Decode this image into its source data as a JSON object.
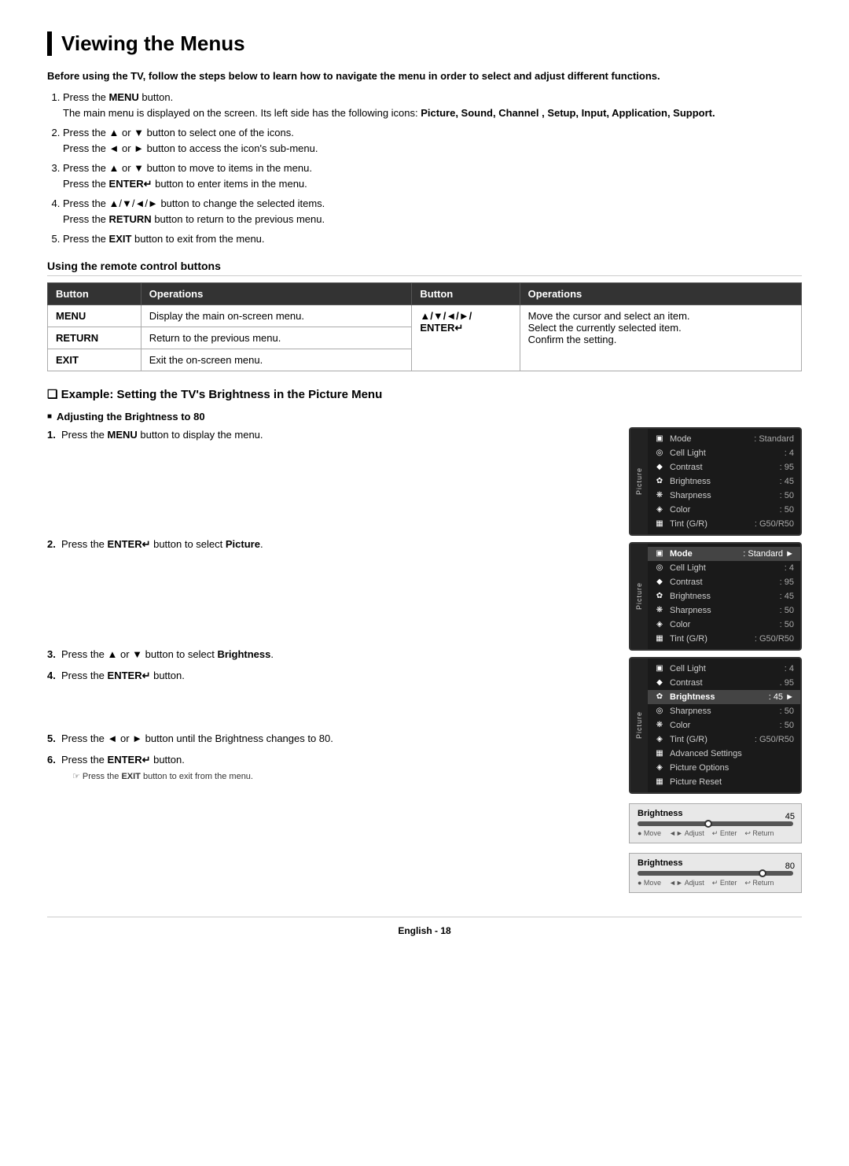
{
  "page": {
    "title": "Viewing the Menus",
    "intro": "Before using the TV, follow the steps below to learn how to navigate the menu in order to select and adjust different functions.",
    "steps": [
      {
        "num": "1.",
        "text": "Press the ",
        "bold1": "MENU",
        "text2": " button.",
        "sub": "The main menu is displayed on the screen. Its left side has the following icons: ",
        "bold2": "Picture, Sound, Channel , Setup, Input, Application, Support."
      },
      {
        "num": "2.",
        "text": "Press the ▲ or ▼ button to select one of the icons.",
        "sub": "Press the ◄ or ► button to access the icon's sub-menu."
      },
      {
        "num": "3.",
        "text": "Press the ▲ or ▼ button to move to items in the menu.",
        "sub": "Press the ENTER↵ button to enter items in the menu."
      },
      {
        "num": "4.",
        "text": "Press the ▲/▼/◄/► button to change the selected items.",
        "sub": "Press the RETURN button to return to the previous menu."
      },
      {
        "num": "5.",
        "text": "Press the EXIT button to exit from the menu."
      }
    ],
    "remote_section_title": "Using the remote control buttons",
    "table": {
      "headers": [
        "Button",
        "Operations",
        "Button",
        "Operations"
      ],
      "rows": [
        {
          "btn1": "MENU",
          "op1": "Display the main on-screen menu.",
          "btn2": "▲/▼/◄/►/\nENTER↵",
          "op2": "Move the cursor and select an item.\nSelect the currently selected item.\nConfirm the setting."
        },
        {
          "btn1": "RETURN",
          "op1": "Return to the previous menu.",
          "btn2": "",
          "op2": ""
        },
        {
          "btn1": "EXIT",
          "op1": "Exit the on-screen menu.",
          "btn2": "",
          "op2": ""
        }
      ]
    },
    "example_title": "Example: Setting the TV's Brightness in the Picture Menu",
    "adjusting_title": "Adjusting the Brightness to 80",
    "example_steps": [
      {
        "num": "1.",
        "text": "Press the ",
        "bold": "MENU",
        "text2": " button to display the menu."
      },
      {
        "num": "2.",
        "text": "Press the ",
        "bold": "ENTER↵",
        "text2": " button to select ",
        "bold2": "Picture",
        "text3": "."
      },
      {
        "num": "3.",
        "text": "Press the ▲ or ▼ button to select ",
        "bold": "Brightness",
        "text2": "."
      },
      {
        "num": "4.",
        "text": "Press the ",
        "bold": "ENTER↵",
        "text2": " button."
      },
      {
        "num": "5.",
        "text": "Press the ◄ or ► button until the Brightness changes to 80."
      },
      {
        "num": "6.",
        "text": "Press the ",
        "bold": "ENTER↵",
        "text2": " button.",
        "sub": "Press the EXIT button to exit from the menu.",
        "note": true
      }
    ],
    "menus": [
      {
        "id": "menu1",
        "sidebar": "Picture",
        "highlighted": null,
        "header_highlighted": false,
        "rows": [
          {
            "icon": "▣",
            "label": "Mode",
            "value": ": Standard"
          },
          {
            "icon": "◎",
            "label": "Cell Light",
            "value": ": 4"
          },
          {
            "icon": "◆",
            "label": "Contrast",
            "value": ": 95"
          },
          {
            "icon": "✿",
            "label": "Brightness",
            "value": ": 45"
          },
          {
            "icon": "❋",
            "label": "Sharpness",
            "value": ": 50"
          },
          {
            "icon": "◈",
            "label": "Color",
            "value": ": 50"
          },
          {
            "icon": "▦",
            "label": "Tint (G/R)",
            "value": ": G50/R50"
          }
        ]
      },
      {
        "id": "menu2",
        "sidebar": "Picture",
        "highlighted": "Mode",
        "header_highlighted": true,
        "rows": [
          {
            "icon": "▣",
            "label": "Mode",
            "value": ": Standard ►",
            "hl": true
          },
          {
            "icon": "◎",
            "label": "Cell Light",
            "value": ": 4"
          },
          {
            "icon": "◆",
            "label": "Contrast",
            "value": ": 95"
          },
          {
            "icon": "✿",
            "label": "Brightness",
            "value": ": 45"
          },
          {
            "icon": "❋",
            "label": "Sharpness",
            "value": ": 50"
          },
          {
            "icon": "◈",
            "label": "Color",
            "value": ": 50"
          },
          {
            "icon": "▦",
            "label": "Tint (G/R)",
            "value": ": G50/R50"
          }
        ]
      },
      {
        "id": "menu3",
        "sidebar": "Picture",
        "highlighted": "Brightness",
        "header_highlighted": false,
        "rows": [
          {
            "icon": "▣",
            "label": "Cell Light",
            "value": ": 4"
          },
          {
            "icon": "◆",
            "label": "Contrast",
            "value": ": 95",
            "dot": true
          },
          {
            "icon": "✿",
            "label": "Brightness",
            "value": ": 45 ►",
            "hl": true
          },
          {
            "icon": "◎",
            "label": "Sharpness",
            "value": ": 50"
          },
          {
            "icon": "❋",
            "label": "Color",
            "value": ": 50"
          },
          {
            "icon": "◈",
            "label": "Tint (G/R)",
            "value": ": G50/R50"
          },
          {
            "icon": "▦",
            "label": "Advanced Settings",
            "value": ""
          },
          {
            "icon": "◈",
            "label": "Picture Options",
            "value": ""
          },
          {
            "icon": "▦",
            "label": "Picture Reset",
            "value": ""
          }
        ]
      }
    ],
    "brightness_bars": [
      {
        "label": "Brightness",
        "fill_pct": 45,
        "value": "45",
        "controls": [
          "● Move",
          "◄► Adjust",
          "↵ Enter",
          "↩ Return"
        ]
      },
      {
        "label": "Brightness",
        "fill_pct": 80,
        "value": "80",
        "controls": [
          "● Move",
          "◄► Adjust",
          "↵ Enter",
          "↩ Return"
        ]
      }
    ],
    "footer": "English - 18"
  }
}
